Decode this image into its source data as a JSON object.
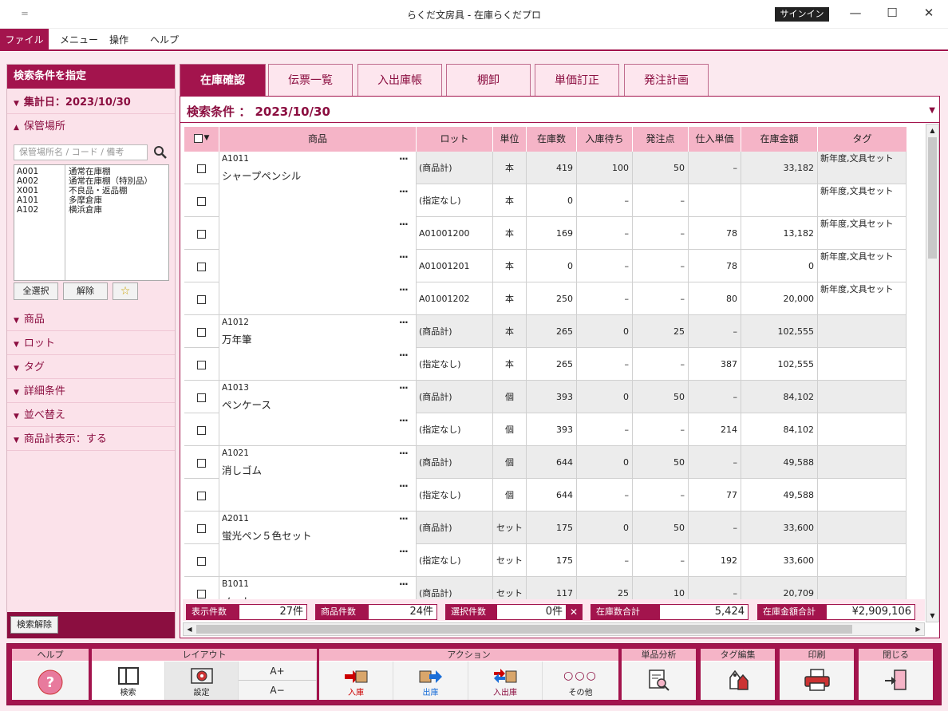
{
  "window": {
    "title": "らくだ文房具 - 在庫らくだプロ",
    "quick_access": "＝",
    "signin": "サインイン"
  },
  "menu": {
    "file": "ファイル",
    "items": [
      "メニュー",
      "操作",
      "ヘルプ"
    ]
  },
  "sidebar": {
    "title": "検索条件を指定",
    "date_filter": "集計日：2023/10/30",
    "location_section": "保管場所",
    "location_placeholder": "保管場所名 / コード / 備考",
    "locations": [
      {
        "code": "A001",
        "name": "通常在庫棚"
      },
      {
        "code": "A002",
        "name": "通常在庫棚（特別品）"
      },
      {
        "code": "X001",
        "name": "不良品・返品棚"
      },
      {
        "code": "A101",
        "name": "多摩倉庫"
      },
      {
        "code": "A102",
        "name": "横浜倉庫"
      }
    ],
    "select_all": "全選択",
    "deselect": "解除",
    "star": "☆",
    "sections": [
      "商品",
      "ロット",
      "タグ",
      "詳細条件",
      "並べ替え",
      "商品計表示：する"
    ],
    "clear": "検索解除"
  },
  "tabs": [
    "在庫確認",
    "伝票一覧",
    "入出庫帳",
    "棚卸",
    "単価訂正",
    "発注計画"
  ],
  "condition": "検索条件 ： 2023/10/30",
  "table": {
    "headers": [
      "商品",
      "ロット",
      "単位",
      "在庫数",
      "入庫待ち",
      "発注点",
      "仕入単価",
      "在庫金額",
      "タグ"
    ],
    "groups": [
      {
        "code": "A1011",
        "name": "シャープペンシル",
        "rows": [
          {
            "lot": "(商品計)",
            "unit": "本",
            "stock": "419",
            "pending": "100",
            "reorder": "50",
            "price": "–",
            "amount": "33,182",
            "tag": "新年度,文具セット",
            "sum": true
          },
          {
            "lot": "(指定なし)",
            "unit": "本",
            "stock": "0",
            "pending": "–",
            "reorder": "–",
            "price": "",
            "amount": "",
            "tag": "新年度,文具セット",
            "sum": false
          },
          {
            "lot": "A01001200",
            "unit": "本",
            "stock": "169",
            "pending": "–",
            "reorder": "–",
            "price": "78",
            "amount": "13,182",
            "tag": "新年度,文具セット",
            "sum": false
          },
          {
            "lot": "A01001201",
            "unit": "本",
            "stock": "0",
            "pending": "–",
            "reorder": "–",
            "price": "78",
            "amount": "0",
            "tag": "新年度,文具セット",
            "sum": false
          },
          {
            "lot": "A01001202",
            "unit": "本",
            "stock": "250",
            "pending": "–",
            "reorder": "–",
            "price": "80",
            "amount": "20,000",
            "tag": "新年度,文具セット",
            "sum": false
          }
        ]
      },
      {
        "code": "A1012",
        "name": "万年筆",
        "rows": [
          {
            "lot": "(商品計)",
            "unit": "本",
            "stock": "265",
            "pending": "0",
            "reorder": "25",
            "price": "–",
            "amount": "102,555",
            "tag": "",
            "sum": true
          },
          {
            "lot": "(指定なし)",
            "unit": "本",
            "stock": "265",
            "pending": "–",
            "reorder": "–",
            "price": "387",
            "amount": "102,555",
            "tag": "",
            "sum": false
          }
        ]
      },
      {
        "code": "A1013",
        "name": "ペンケース",
        "rows": [
          {
            "lot": "(商品計)",
            "unit": "個",
            "stock": "393",
            "pending": "0",
            "reorder": "50",
            "price": "–",
            "amount": "84,102",
            "tag": "",
            "sum": true
          },
          {
            "lot": "(指定なし)",
            "unit": "個",
            "stock": "393",
            "pending": "–",
            "reorder": "–",
            "price": "214",
            "amount": "84,102",
            "tag": "",
            "sum": false
          }
        ]
      },
      {
        "code": "A1021",
        "name": "消しゴム",
        "rows": [
          {
            "lot": "(商品計)",
            "unit": "個",
            "stock": "644",
            "pending": "0",
            "reorder": "50",
            "price": "–",
            "amount": "49,588",
            "tag": "",
            "sum": true
          },
          {
            "lot": "(指定なし)",
            "unit": "個",
            "stock": "644",
            "pending": "–",
            "reorder": "–",
            "price": "77",
            "amount": "49,588",
            "tag": "",
            "sum": false
          }
        ]
      },
      {
        "code": "A2011",
        "name": "蛍光ペン５色セット",
        "rows": [
          {
            "lot": "(商品計)",
            "unit": "セット",
            "stock": "175",
            "pending": "0",
            "reorder": "50",
            "price": "–",
            "amount": "33,600",
            "tag": "",
            "sum": true
          },
          {
            "lot": "(指定なし)",
            "unit": "セット",
            "stock": "175",
            "pending": "–",
            "reorder": "–",
            "price": "192",
            "amount": "33,600",
            "tag": "",
            "sum": false
          }
        ]
      },
      {
        "code": "B1011",
        "name": "ノート",
        "rows": [
          {
            "lot": "(商品計)",
            "unit": "セット",
            "stock": "117",
            "pending": "25",
            "reorder": "10",
            "price": "–",
            "amount": "20,709",
            "tag": "",
            "sum": true
          }
        ]
      }
    ]
  },
  "stats": {
    "displayed_label": "表示件数",
    "displayed": "27件",
    "products_label": "商品件数",
    "products": "24件",
    "selected_label": "選択件数",
    "selected": "0件",
    "total_qty_label": "在庫数合計",
    "total_qty": "5,424",
    "total_amount_label": "在庫金額合計",
    "total_amount": "¥2,909,106"
  },
  "toolbar": {
    "help_group": "ヘルプ",
    "layout_group": "レイアウト",
    "search": "検索",
    "settings": "設定",
    "font_up": "A+",
    "font_down": "A−",
    "action_group": "アクション",
    "inbound": "入庫",
    "outbound": "出庫",
    "inout": "入出庫",
    "other": "その他",
    "analysis_group": "単品分析",
    "tag_group": "タグ編集",
    "print_group": "印刷",
    "close_group": "閉じる"
  }
}
